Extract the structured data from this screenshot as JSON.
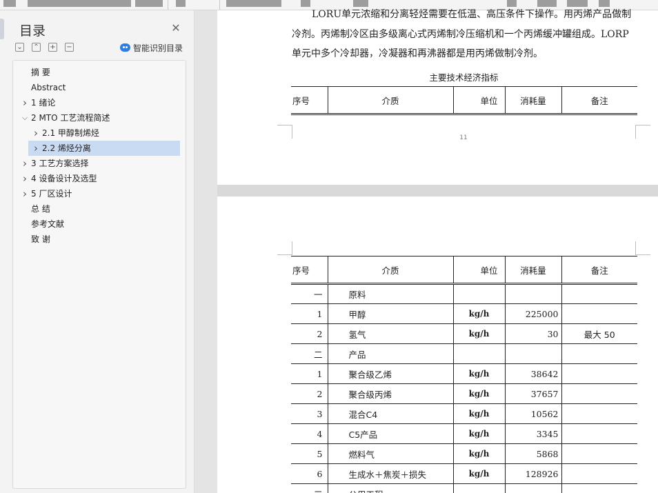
{
  "toc": {
    "title": "目录",
    "smart_label": "智能识别目录",
    "items": [
      {
        "label": "摘 要",
        "level": 0,
        "expandable": false,
        "expanded": false,
        "selected": false
      },
      {
        "label": "Abstract",
        "level": 0,
        "expandable": false,
        "expanded": false,
        "selected": false
      },
      {
        "label": "1 绪论",
        "level": 0,
        "expandable": true,
        "expanded": false,
        "selected": false
      },
      {
        "label": "2 MTO 工艺流程简述",
        "level": 0,
        "expandable": true,
        "expanded": true,
        "selected": false
      },
      {
        "label": "2.1 甲醇制烯烃",
        "level": 1,
        "expandable": true,
        "expanded": false,
        "selected": false
      },
      {
        "label": "2.2 烯烃分离",
        "level": 1,
        "expandable": true,
        "expanded": false,
        "selected": true
      },
      {
        "label": "3 工艺方案选择",
        "level": 0,
        "expandable": true,
        "expanded": false,
        "selected": false
      },
      {
        "label": "4 设备设计及选型",
        "level": 0,
        "expandable": true,
        "expanded": false,
        "selected": false
      },
      {
        "label": "5 厂区设计",
        "level": 0,
        "expandable": true,
        "expanded": false,
        "selected": false
      },
      {
        "label": "总 结",
        "level": 0,
        "expandable": false,
        "expanded": false,
        "selected": false
      },
      {
        "label": "参考文献",
        "level": 0,
        "expandable": false,
        "expanded": false,
        "selected": false
      },
      {
        "label": "致 谢",
        "level": 0,
        "expandable": false,
        "expanded": false,
        "selected": false
      }
    ]
  },
  "doc": {
    "para_lines": [
      "LORU单元浓缩和分离轻烃需要在低温、高压条件下操作。用丙烯产品做制",
      "冷剂。丙烯制冷区由多级离心式丙烯制冷压缩机和一个丙烯缓冲罐组成。LORP",
      "单元中多个冷却器，冷凝器和再沸器都是用丙烯做制冷剂。"
    ],
    "caption": "主要技术经济指标",
    "page_number": "11",
    "table": {
      "headers": [
        "序号",
        "介质",
        "单位",
        "消耗量",
        "备注"
      ],
      "rows": [
        [
          "一",
          "原料",
          "",
          "",
          ""
        ],
        [
          "1",
          "甲醇",
          "kg/h",
          "225000",
          ""
        ],
        [
          "2",
          "氢气",
          "kg/h",
          "30",
          "最大 50"
        ],
        [
          "二",
          "产品",
          "",
          "",
          ""
        ],
        [
          "1",
          "聚合级乙烯",
          "kg/h",
          "38642",
          ""
        ],
        [
          "2",
          "聚合级丙烯",
          "kg/h",
          "37657",
          ""
        ],
        [
          "3",
          "混合C4",
          "kg/h",
          "10562",
          ""
        ],
        [
          "4",
          "C5产品",
          "kg/h",
          "3345",
          ""
        ],
        [
          "5",
          "燃料气",
          "kg/h",
          "5868",
          ""
        ],
        [
          "6",
          "生成水＋焦炭＋损失",
          "kg/h",
          "128926",
          ""
        ],
        [
          "三",
          "公用工程",
          "",
          "",
          ""
        ]
      ]
    }
  }
}
